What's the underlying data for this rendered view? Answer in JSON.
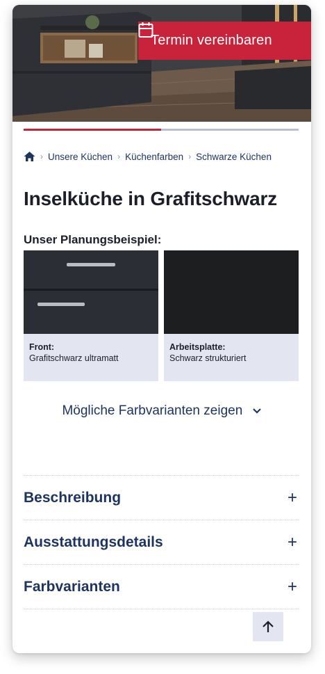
{
  "hero": {
    "cta_label": "Termin vereinbaren",
    "cta_icon": "calendar-icon",
    "cta_color": "#c8233a"
  },
  "progress": {
    "fraction": 0.5
  },
  "breadcrumb": {
    "home_icon": "home-icon",
    "items": [
      "Unsere Küchen",
      "Küchenfarben",
      "Schwarze Küchen"
    ]
  },
  "page_title": "Inselküche in Grafitschwarz",
  "planning": {
    "heading": "Unser Planungsbeispiel:",
    "tiles": [
      {
        "title": "Front:",
        "value": "Grafitschwarz ultramatt"
      },
      {
        "title": "Arbeitsplatte:",
        "value": "Schwarz strukturiert"
      }
    ]
  },
  "variants_link": {
    "label": "Mögliche Farbvarianten zeigen",
    "icon": "chevron-down-icon"
  },
  "accordion": [
    {
      "label": "Beschreibung",
      "icon": "plus-icon"
    },
    {
      "label": "Ausstattungsdetails",
      "icon": "plus-icon"
    },
    {
      "label": "Farbvarianten",
      "icon": "plus-icon"
    }
  ],
  "back_to_top": {
    "icon": "arrow-up-icon"
  },
  "colors": {
    "accent": "#c8233a",
    "navy": "#1d3461",
    "tile_bg": "#e3e6f0"
  }
}
